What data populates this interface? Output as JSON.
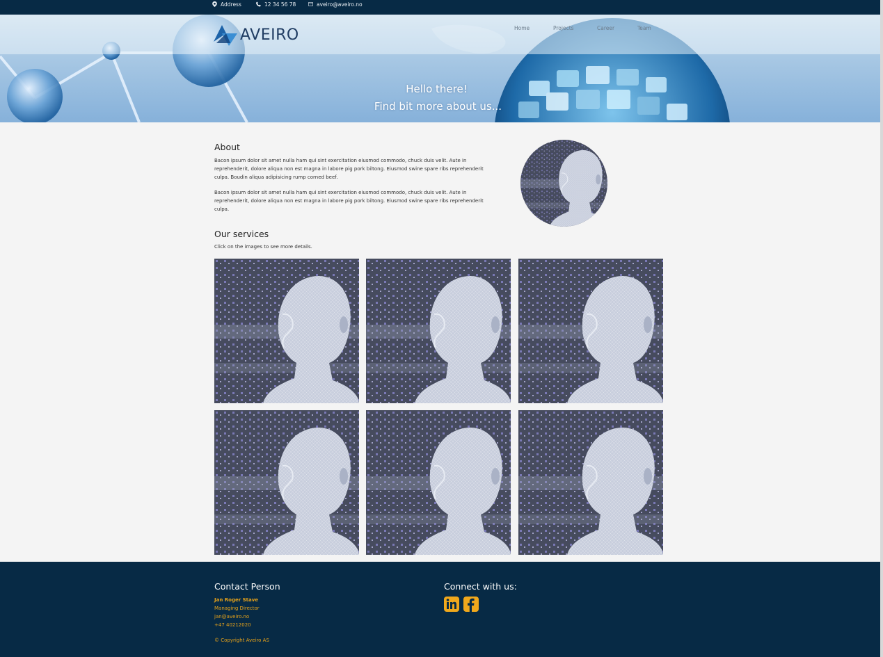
{
  "topbar": {
    "address": "Address",
    "phone": "12 34 56 78",
    "email": "aveiro@aveiro.no"
  },
  "header": {
    "logo_text": "AVEIRO",
    "nav": [
      "Home",
      "Projects",
      "Career",
      "Team"
    ]
  },
  "hero": {
    "line1": "Hello there!",
    "line2": "Find bit more about us..."
  },
  "about": {
    "title": "About",
    "paragraphs": [
      "Bacon ipsum dolor sit amet nulla ham qui sint exercitation eiusmod commodo, chuck duis velit. Aute in reprehenderit, dolore aliqua non est magna in labore pig pork biltong. Eiusmod swine spare ribs reprehenderit culpa. Boudin aliqua adipisicing rump corned beef.",
      "Bacon ipsum dolor sit amet nulla ham qui sint exercitation eiusmod commodo, chuck duis velit. Aute in reprehenderit, dolore aliqua non est magna in labore pig pork biltong. Eiusmod swine spare ribs reprehenderit culpa."
    ]
  },
  "services": {
    "title": "Our services",
    "subtitle": "Click on the images to see more details."
  },
  "footer": {
    "contact_title": "Contact Person",
    "contact_name": "Jan Roger Stave",
    "contact_role": "Managing Director",
    "contact_email": "jan@aveiro.no",
    "contact_phone": "+47 40212020",
    "copyright": "© Copyright Aveiro AS",
    "connect_title": "Connect with us:",
    "social_icons": [
      "linkedin-icon",
      "facebook-icon"
    ]
  },
  "colors": {
    "navy": "#072a45",
    "accent": "#f0a81c",
    "background": "#f4f4f4"
  }
}
